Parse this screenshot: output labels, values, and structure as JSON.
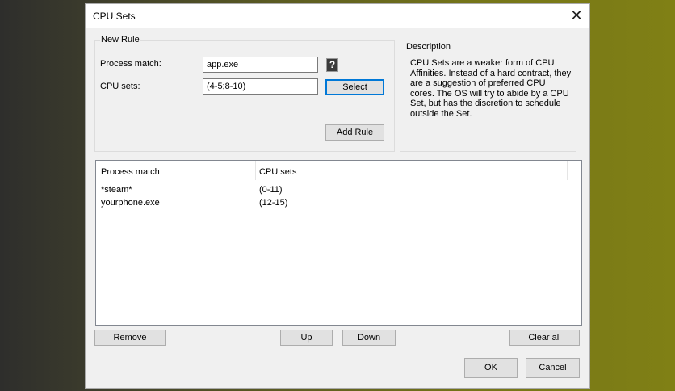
{
  "title": "CPU Sets",
  "new_rule": {
    "label": "New Rule",
    "process_label": "Process match:",
    "process_value": "app.exe",
    "cpu_label": "CPU sets:",
    "cpu_value": "(4-5;8-10)",
    "help": "?",
    "select": "Select",
    "add_rule": "Add Rule"
  },
  "description": {
    "label": "Description",
    "text": "CPU Sets are a weaker form of CPU Affinities. Instead of a hard contract, they are a suggestion of preferred CPU cores. The OS will try to abide by a CPU Set, but has the discretion to schedule outside the Set."
  },
  "list": {
    "columns": [
      "Process match",
      "CPU sets"
    ],
    "rows": [
      [
        "*steam*",
        "(0-11)"
      ],
      [
        "yourphone.exe",
        "(12-15)"
      ]
    ]
  },
  "buttons": {
    "remove": "Remove",
    "up": "Up",
    "down": "Down",
    "clear_all": "Clear all",
    "ok": "OK",
    "cancel": "Cancel"
  },
  "close": "✕"
}
